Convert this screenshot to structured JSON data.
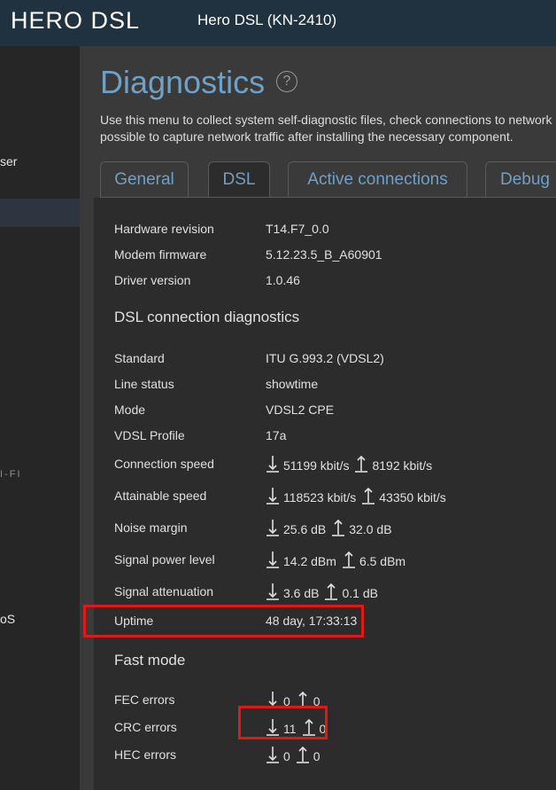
{
  "header": {
    "logo": "HERO DSL",
    "model": "Hero DSL (KN-2410)"
  },
  "sidebar": {
    "items": [
      {
        "label": "ser"
      },
      {
        "label": ""
      },
      {
        "label": "oS"
      }
    ],
    "section_label": "I-FI"
  },
  "page": {
    "title": "Diagnostics",
    "help": "?",
    "description_line1": "Use this menu to collect system self-diagnostic files, check connections to network",
    "description_line2": "possible to capture network traffic after installing the necessary component."
  },
  "tabs": [
    {
      "label": "General"
    },
    {
      "label": "DSL"
    },
    {
      "label": "Active connections"
    },
    {
      "label": "Debug"
    }
  ],
  "hardware": {
    "hardware_revision_label": "Hardware revision",
    "hardware_revision_value": "T14.F7_0.0",
    "modem_firmware_label": "Modem firmware",
    "modem_firmware_value": "5.12.23.5_B_A60901",
    "driver_version_label": "Driver version",
    "driver_version_value": "1.0.46"
  },
  "dsl_diag": {
    "title": "DSL connection diagnostics",
    "standard_label": "Standard",
    "standard_value": "ITU G.993.2 (VDSL2)",
    "line_status_label": "Line status",
    "line_status_value": "showtime",
    "mode_label": "Mode",
    "mode_value": "VDSL2 CPE",
    "vdsl_profile_label": "VDSL Profile",
    "vdsl_profile_value": "17a",
    "connection_speed_label": "Connection speed",
    "connection_speed_down": "51199 kbit/s",
    "connection_speed_up": "8192 kbit/s",
    "attainable_speed_label": "Attainable speed",
    "attainable_speed_down": "118523 kbit/s",
    "attainable_speed_up": "43350 kbit/s",
    "noise_margin_label": "Noise margin",
    "noise_margin_down": "25.6 dB",
    "noise_margin_up": "32.0 dB",
    "signal_power_label": "Signal power level",
    "signal_power_down": "14.2 dBm",
    "signal_power_up": "6.5 dBm",
    "signal_attenuation_label": "Signal attenuation",
    "signal_attenuation_down": "3.6 dB",
    "signal_attenuation_up": "0.1 dB",
    "uptime_label": "Uptime",
    "uptime_value": "48 day, 17:33:13"
  },
  "fast_mode": {
    "title": "Fast mode",
    "fec_label": "FEC errors",
    "fec_down": "0",
    "fec_up": "0",
    "crc_label": "CRC errors",
    "crc_down": "11",
    "crc_up": "0",
    "hec_label": "HEC errors",
    "hec_down": "0",
    "hec_up": "0"
  },
  "colors": {
    "accent": "#6fa0c6",
    "header_bg": "#20323f",
    "highlight": "#e01818"
  }
}
